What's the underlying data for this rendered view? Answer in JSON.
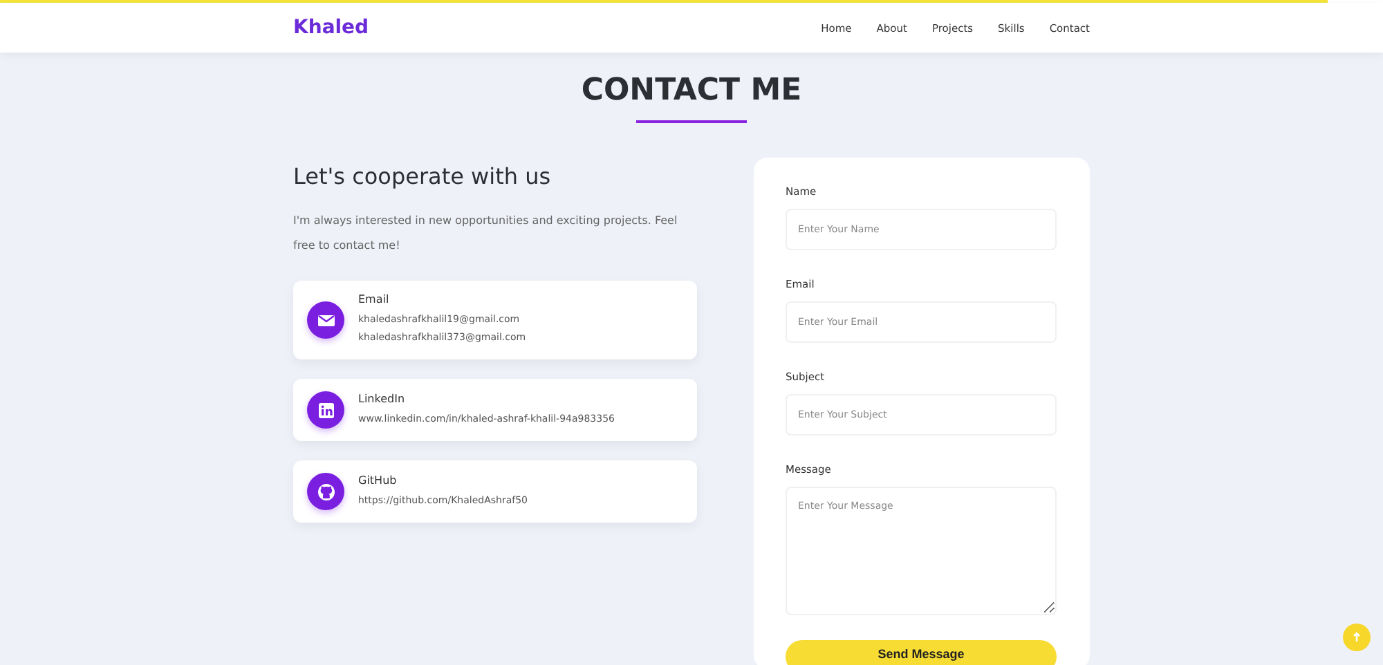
{
  "scroll_progress": {
    "level": 0.96
  },
  "nav": {
    "logo": "Khaled",
    "links": [
      {
        "label": "Home"
      },
      {
        "label": "About"
      },
      {
        "label": "Projects"
      },
      {
        "label": "Skills"
      },
      {
        "label": "Contact"
      }
    ]
  },
  "section": {
    "title": "CONTACT ME"
  },
  "intro": {
    "heading": "Let's cooperate with us",
    "text": "I'm always interested in new opportunities and exciting projects. Feel free to contact me!"
  },
  "contacts": [
    {
      "kind": "email",
      "title": "Email",
      "lines": [
        "khaledashrafkhalil19@gmail.com",
        "khaledashrafkhalil373@gmail.com"
      ]
    },
    {
      "kind": "linkedin",
      "title": "LinkedIn",
      "lines": [
        "www.linkedin.com/in/khaled-ashraf-khalil-94a983356"
      ]
    },
    {
      "kind": "github",
      "title": "GitHub",
      "lines": [
        "https://github.com/KhaledAshraf50"
      ]
    }
  ],
  "form": {
    "fields": [
      {
        "kind": "input",
        "label": "Name",
        "placeholder": "Enter Your Name"
      },
      {
        "kind": "input",
        "label": "Email",
        "placeholder": "Enter Your Email"
      },
      {
        "kind": "input",
        "label": "Subject",
        "placeholder": "Enter Your Subject"
      },
      {
        "kind": "textarea",
        "label": "Message",
        "placeholder": "Enter Your Message"
      }
    ],
    "submit": "Send Message"
  }
}
